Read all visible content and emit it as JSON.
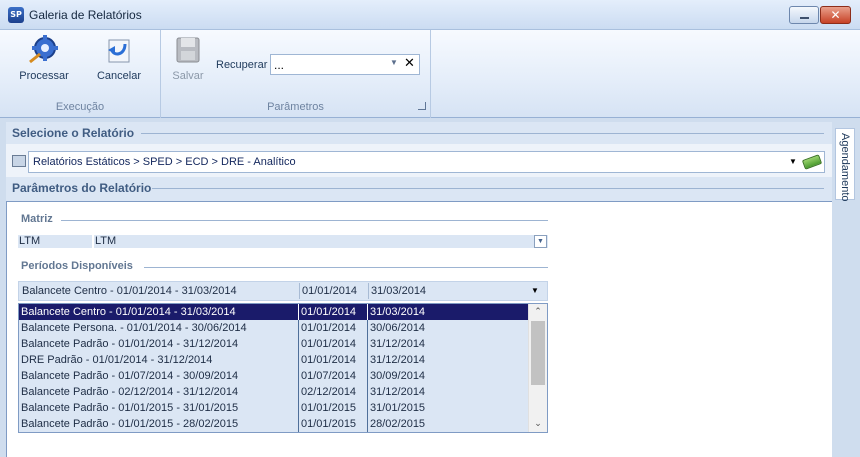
{
  "window": {
    "title": "Galeria de Relatórios",
    "app_icon_text": "SP"
  },
  "ribbon": {
    "execucao": {
      "label": "Execução",
      "processar": "Processar",
      "cancelar": "Cancelar"
    },
    "parametros": {
      "label": "Parâmetros",
      "salvar": "Salvar",
      "recuperar_label": "Recuperar",
      "recuperar_value": "..."
    }
  },
  "relatorio": {
    "section_title": "Selecione o Relatório",
    "path": "Relatórios Estáticos > SPED > ECD > DRE - Analítico"
  },
  "parametros_relatorio": {
    "section_title": "Parâmetros do Relatório",
    "matriz": {
      "title": "Matriz",
      "code": "LTM",
      "value": "LTM"
    },
    "periodos": {
      "title": "Períodos Disponíveis",
      "selected": {
        "name": "Balancete Centro - 01/01/2014 - 31/03/2014",
        "start": "01/01/2014",
        "end": "31/03/2014"
      },
      "rows": [
        {
          "name": "Balancete Centro - 01/01/2014 - 31/03/2014",
          "start": "01/01/2014",
          "end": "31/03/2014"
        },
        {
          "name": "Balancete Persona. - 01/01/2014 - 30/06/2014",
          "start": "01/01/2014",
          "end": "30/06/2014"
        },
        {
          "name": "Balancete Padrão - 01/01/2014 - 31/12/2014",
          "start": "01/01/2014",
          "end": "31/12/2014"
        },
        {
          "name": "DRE Padrão - 01/01/2014 - 31/12/2014",
          "start": "01/01/2014",
          "end": "31/12/2014"
        },
        {
          "name": "Balancete Padrão - 01/07/2014 - 30/09/2014",
          "start": "01/07/2014",
          "end": "30/09/2014"
        },
        {
          "name": "Balancete Padrão - 02/12/2014 - 31/12/2014",
          "start": "02/12/2014",
          "end": "31/12/2014"
        },
        {
          "name": "Balancete Padrão - 01/01/2015 - 31/01/2015",
          "start": "01/01/2015",
          "end": "31/01/2015"
        },
        {
          "name": "Balancete Padrão - 01/01/2015 - 28/02/2015",
          "start": "01/01/2015",
          "end": "28/02/2015"
        }
      ]
    }
  },
  "side_tab": {
    "label": "Agendamento"
  }
}
